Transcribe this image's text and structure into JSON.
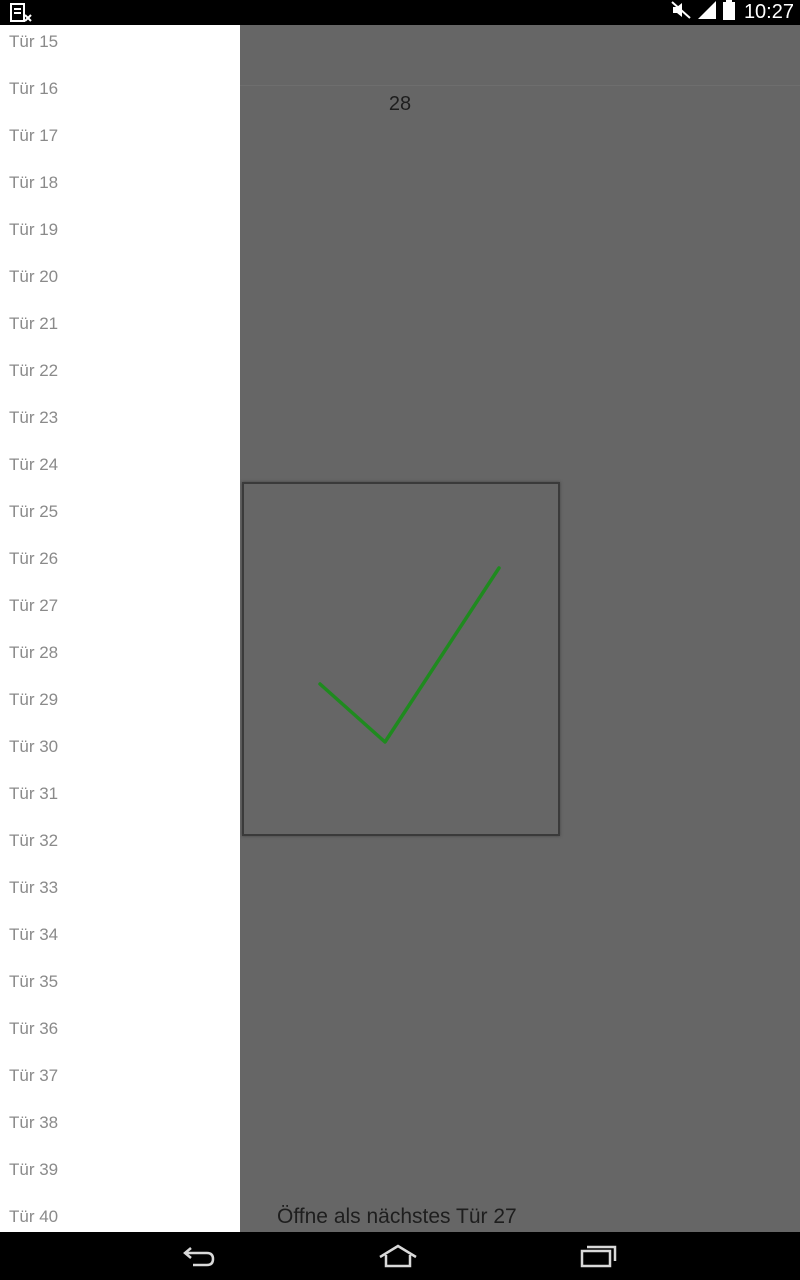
{
  "status_bar": {
    "time": "10:27",
    "left_icon": "sim-card-missing-icon",
    "right_icons": [
      "mute-icon",
      "signal-icon",
      "battery-icon"
    ]
  },
  "main": {
    "counter": "28",
    "check_icon": "checkmark-icon",
    "next_door_text": "Öffne als nächstes Tür 27"
  },
  "drawer": {
    "items": [
      "Tür 15",
      "Tür 16",
      "Tür 17",
      "Tür 18",
      "Tür 19",
      "Tür 20",
      "Tür 21",
      "Tür 22",
      "Tür 23",
      "Tür 24",
      "Tür 25",
      "Tür 26",
      "Tür 27",
      "Tür 28",
      "Tür 29",
      "Tür 30",
      "Tür 31",
      "Tür 32",
      "Tür 33",
      "Tür 34",
      "Tür 35",
      "Tür 36",
      "Tür 37",
      "Tür 38",
      "Tür 39",
      "Tür 40"
    ]
  },
  "nav_bar": {
    "buttons": [
      "back-icon",
      "home-icon",
      "recent-apps-icon"
    ]
  },
  "colors": {
    "drawer_bg": "#ffffff",
    "drawer_text": "#8a8a8a",
    "scrim": "#666666",
    "check": "#1f8a1f",
    "bar_bg": "#000000"
  }
}
